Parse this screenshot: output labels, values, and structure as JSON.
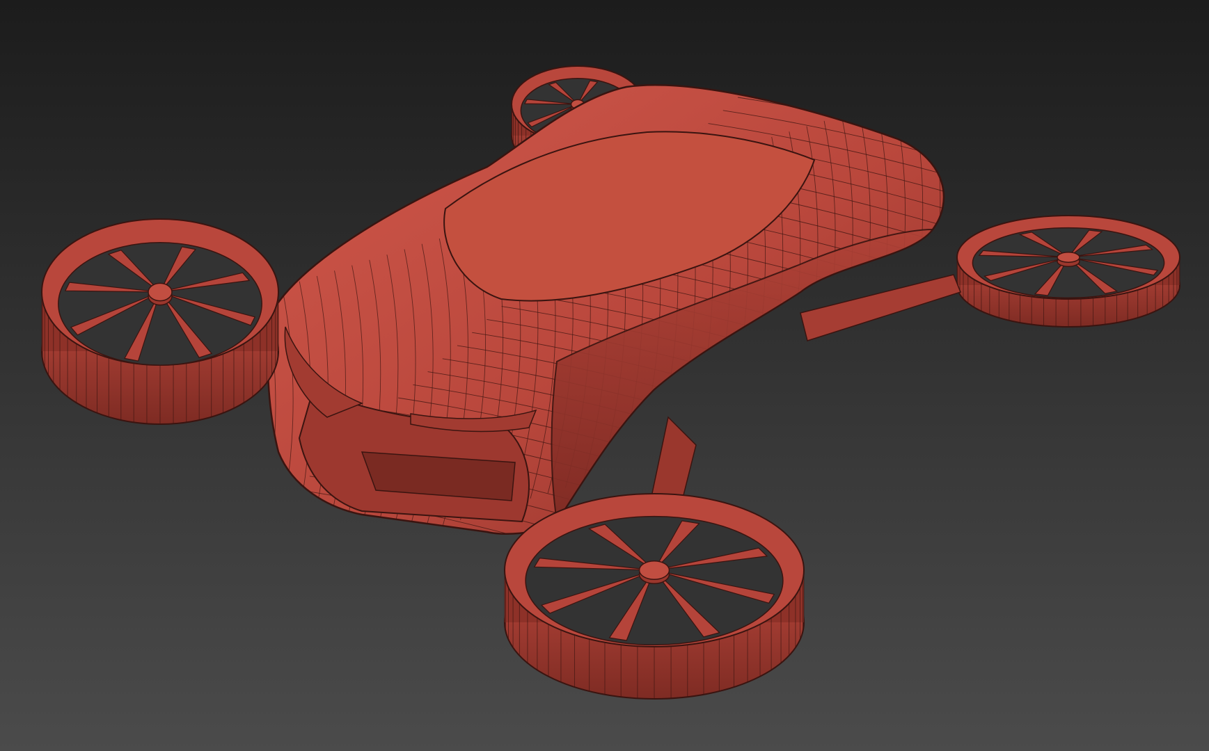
{
  "viewport": {
    "background_top": "#1c1c1c",
    "background_bottom": "#4b4b4b"
  },
  "model": {
    "surface_color": "#b9473c",
    "surface_light": "#d0584b",
    "surface_dark": "#8a3028",
    "wire_color": "#3a1410",
    "rotor_count": 4,
    "blades_per_rotor": 8,
    "icon": "flying-car-wireframe-icon"
  }
}
